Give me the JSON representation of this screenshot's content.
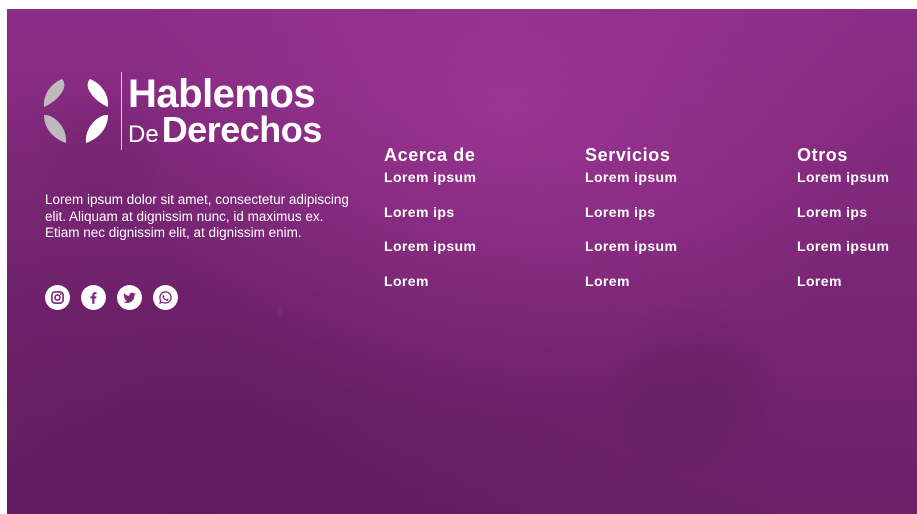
{
  "brand": {
    "name_line1": "Hablemos",
    "name_prefix": "De",
    "name_main": "Derechos",
    "logo_icon": "leaf-shield-icon"
  },
  "description": "Lorem ipsum dolor sit amet, consectetur adipiscing elit. Aliquam at dignissim nunc, id maximus ex. Etiam nec dignissim elit, at dignissim enim.",
  "social": [
    {
      "name": "instagram-icon"
    },
    {
      "name": "facebook-icon"
    },
    {
      "name": "twitter-icon"
    },
    {
      "name": "whatsapp-icon"
    }
  ],
  "columns": [
    {
      "title": "Acerca de",
      "links": [
        "Lorem ipsum",
        "Lorem ips",
        "Lorem ipsum",
        "Lorem"
      ]
    },
    {
      "title": "Servicios",
      "links": [
        "Lorem ipsum",
        "Lorem ips",
        "Lorem ipsum",
        "Lorem"
      ]
    },
    {
      "title": "Otros",
      "links": [
        "Lorem ipsum",
        "Lorem ips",
        "Lorem ipsum",
        "Lorem"
      ]
    }
  ],
  "colors": {
    "background": "#7d2778",
    "text": "#ffffff",
    "logo_gray": "#bcbcbc"
  }
}
